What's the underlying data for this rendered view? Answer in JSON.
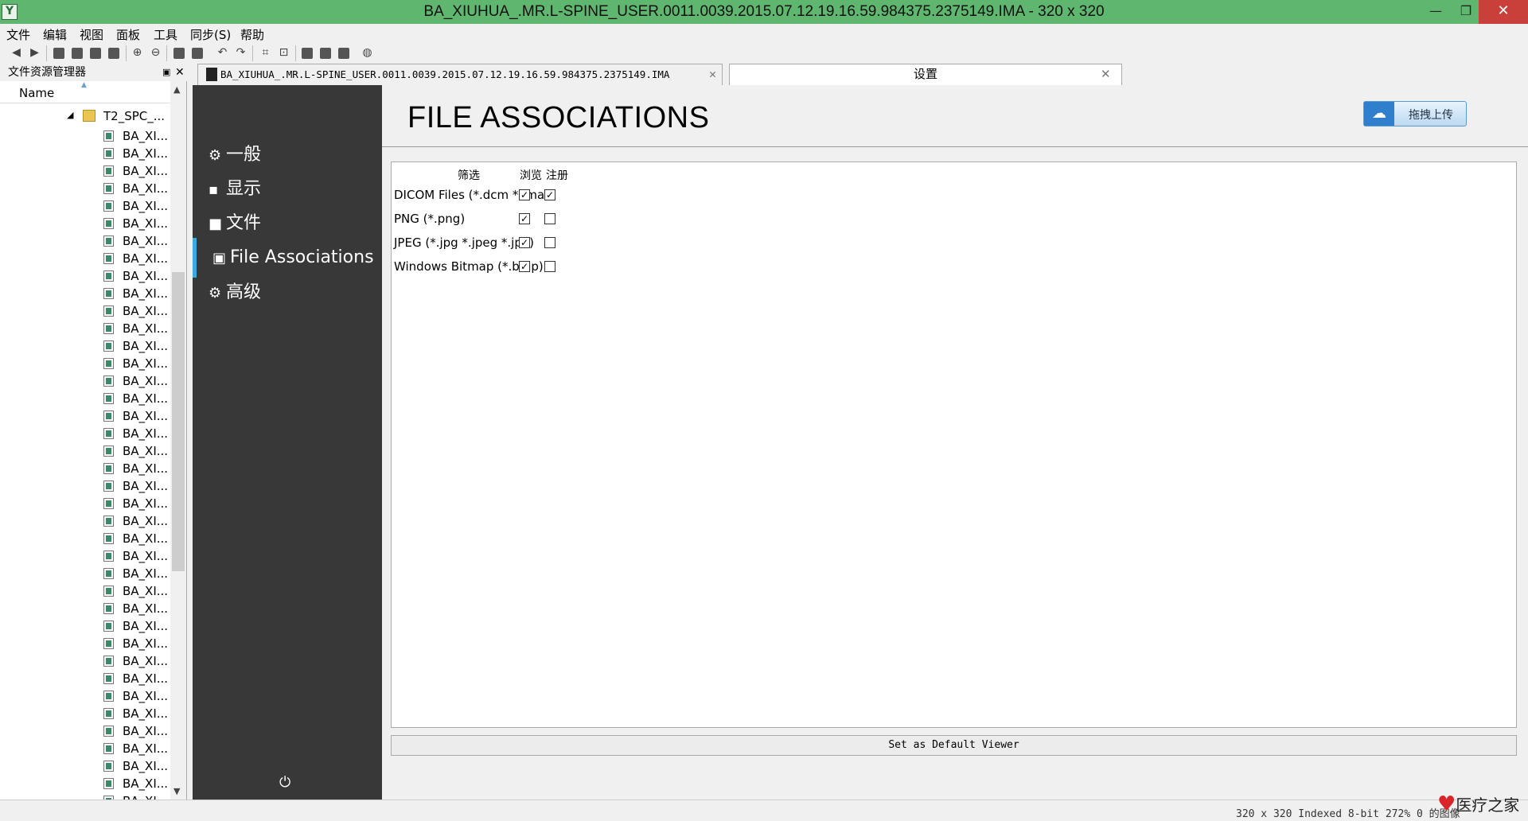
{
  "window": {
    "title": "BA_XIUHUA_.MR.L-SPINE_USER.0011.0039.2015.07.12.19.16.59.984375.2375149.IMA  - 320 x 320",
    "min": "—",
    "max": "❐",
    "close": "✕"
  },
  "menu": [
    "文件",
    "编辑",
    "视图",
    "面板",
    "工具",
    "同步(S)",
    "帮助"
  ],
  "explorer": {
    "title": "文件资源管理器",
    "column": "Name",
    "folder": "T2_SPC_...",
    "file_label": "BA_XI..."
  },
  "tabs": {
    "image": "BA_XIUHUA_.MR.L-SPINE_USER.0011.0039.2015.07.12.19.16.59.984375.2375149.IMA",
    "settings": "设置"
  },
  "nav": [
    {
      "label": "一般",
      "icon": "gear-icon"
    },
    {
      "label": "显示",
      "icon": "monitor-icon"
    },
    {
      "label": "文件",
      "icon": "folder-icon"
    },
    {
      "label": "File Associations",
      "icon": "file-association-icon"
    },
    {
      "label": "高级",
      "icon": "gear-icon"
    }
  ],
  "page": {
    "title": "FILE ASSOCIATIONS",
    "upload_button": "拖拽上传",
    "columns": {
      "filter": "筛选",
      "browse": "浏览",
      "register": "注册"
    },
    "rows": [
      {
        "label": "DICOM Files (*.dcm *.ima)",
        "browse": true,
        "register": true
      },
      {
        "label": "PNG (*.png)",
        "browse": true,
        "register": false
      },
      {
        "label": "JPEG (*.jpg *.jpeg *.jpe)",
        "browse": true,
        "register": false
      },
      {
        "label": "Windows Bitmap (*.bmp)",
        "browse": true,
        "register": false
      }
    ],
    "default_button": "Set as Default Viewer"
  },
  "status": {
    "text": "320 x 320 Indexed 8-bit 272% 0 的图像"
  },
  "watermark": "医疗之家"
}
